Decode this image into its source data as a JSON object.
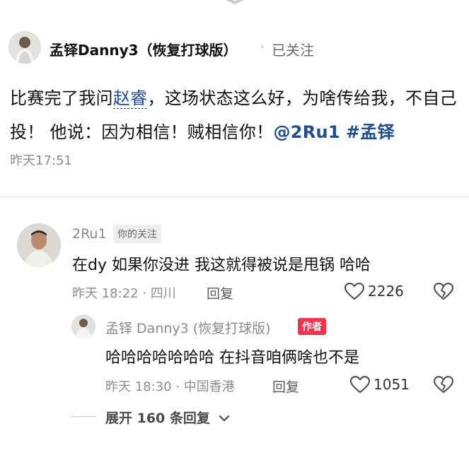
{
  "post": {
    "author": "孟铎Danny3（恢复打球版）",
    "follow_separator": "·",
    "follow_label": "已关注",
    "text_part1": "比赛完了我问",
    "mention": "赵睿",
    "text_part2": "，这场状态这么好，为啥传给我，不自己投！ 他说：因为相信！贼相信你！",
    "at_user": "@2Ru1",
    "hashtag": "#孟铎",
    "time": "昨天17:51"
  },
  "comments": [
    {
      "user": "2Ru1",
      "tag": "你的关注",
      "text": "在dy 如果你没进 我这就得被说是甩锅 哈哈",
      "meta": "昨天 18:22 · 四川",
      "reply_label": "回复",
      "likes": "2226"
    },
    {
      "user": "孟铎 Danny3 (恢复打球版)",
      "tag": "作者",
      "text": "哈哈哈哈哈哈哈 在抖音咱俩啥也不是",
      "meta": "昨天 18:30 · 中国香港",
      "reply_label": "回复",
      "likes": "1051"
    }
  ],
  "expand": {
    "label": "展开 160 条回复"
  },
  "colors": {
    "link": "#1f4d8f",
    "author_tag": "#f0344c"
  },
  "icons": [
    "chevron-up-icon",
    "heart-icon",
    "broken-heart-icon",
    "chevron-down-icon"
  ]
}
